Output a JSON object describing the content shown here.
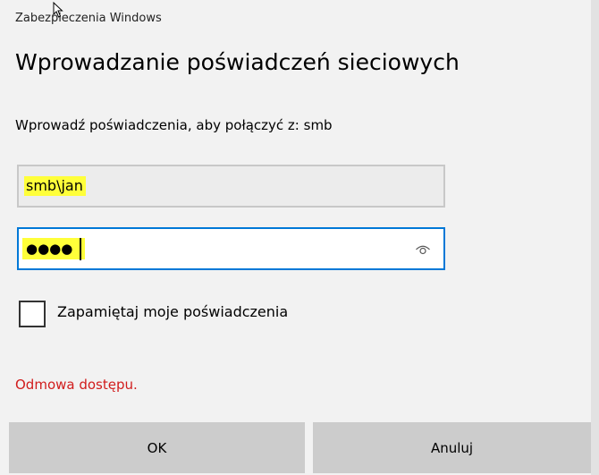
{
  "window": {
    "header_title": "Zabezpieczenia Windows"
  },
  "dialog": {
    "title": "Wprowadzanie poświadczeń sieciowych",
    "subtitle": "Wprowadź poświadczenia, aby połączyć z: smb"
  },
  "username_field": {
    "value": "smb\\jan"
  },
  "password_field": {
    "masked_value": "●●●●",
    "reveal_icon": "eye-icon"
  },
  "remember": {
    "label": "Zapamiętaj moje poświadczenia",
    "checked": false
  },
  "error": {
    "message": "Odmowa dostępu.",
    "color": "#d11c1c"
  },
  "buttons": {
    "ok_label": "OK",
    "cancel_label": "Anuluj"
  },
  "colors": {
    "focus_border": "#0078d7",
    "highlight": "#ffff3a"
  }
}
